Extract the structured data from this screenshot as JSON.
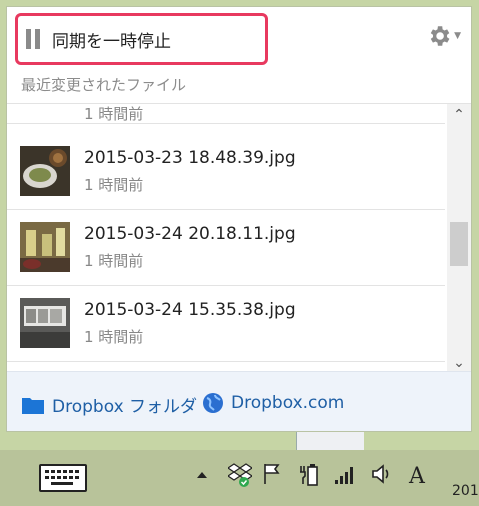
{
  "header": {
    "pause_label": "同期を一時停止"
  },
  "section_title": "最近変更されたファイル",
  "files": [
    {
      "name": "",
      "time": "1 時間前"
    },
    {
      "name": "2015-03-23 18.48.39.jpg",
      "time": "1 時間前"
    },
    {
      "name": "2015-03-24 20.18.11.jpg",
      "time": "1 時間前"
    },
    {
      "name": "2015-03-24 15.35.38.jpg",
      "time": "1 時間前"
    }
  ],
  "footer": {
    "folder_link": "Dropbox フォルダ",
    "web_link": "Dropbox.com"
  },
  "taskbar": {
    "ime_label": "A",
    "clock_partial": "201"
  },
  "colors": {
    "highlight": "#e8395f",
    "link": "#1f5fa5",
    "desktop": "#c6d5a5"
  }
}
